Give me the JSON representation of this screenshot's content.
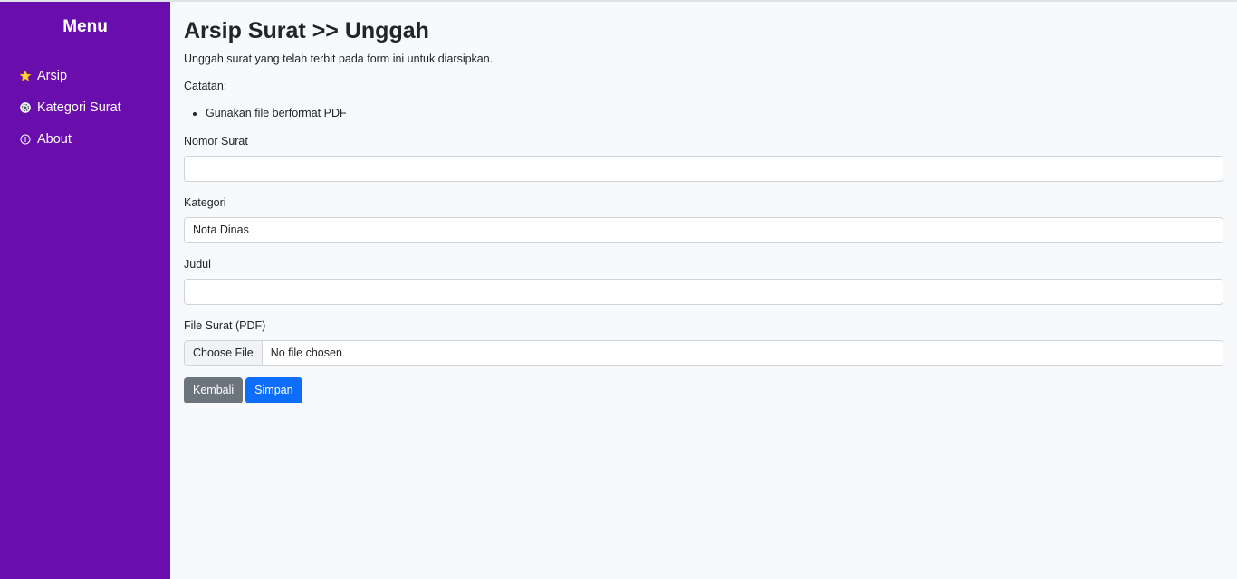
{
  "sidebar": {
    "title": "Menu",
    "items": [
      {
        "label": "Arsip",
        "icon": "star-icon"
      },
      {
        "label": "Kategori Surat",
        "icon": "gear-icon"
      },
      {
        "label": "About",
        "icon": "info-icon"
      }
    ]
  },
  "main": {
    "title": "Arsip Surat >> Unggah",
    "subtitle": "Unggah surat yang telah terbit pada form ini untuk diarsipkan.",
    "note_label": "Catatan:",
    "notes": [
      "Gunakan file berformat PDF"
    ],
    "fields": {
      "nomor_surat": {
        "label": "Nomor Surat",
        "value": ""
      },
      "kategori": {
        "label": "Kategori",
        "value": "Nota Dinas"
      },
      "judul": {
        "label": "Judul",
        "value": ""
      },
      "file": {
        "label": "File Surat (PDF)",
        "button": "Choose File",
        "status": "No file chosen"
      }
    },
    "buttons": {
      "back": "Kembali",
      "save": "Simpan"
    }
  },
  "colors": {
    "sidebar": "#6a0dad",
    "primary": "#0d6efd",
    "secondary": "#6c757d"
  }
}
